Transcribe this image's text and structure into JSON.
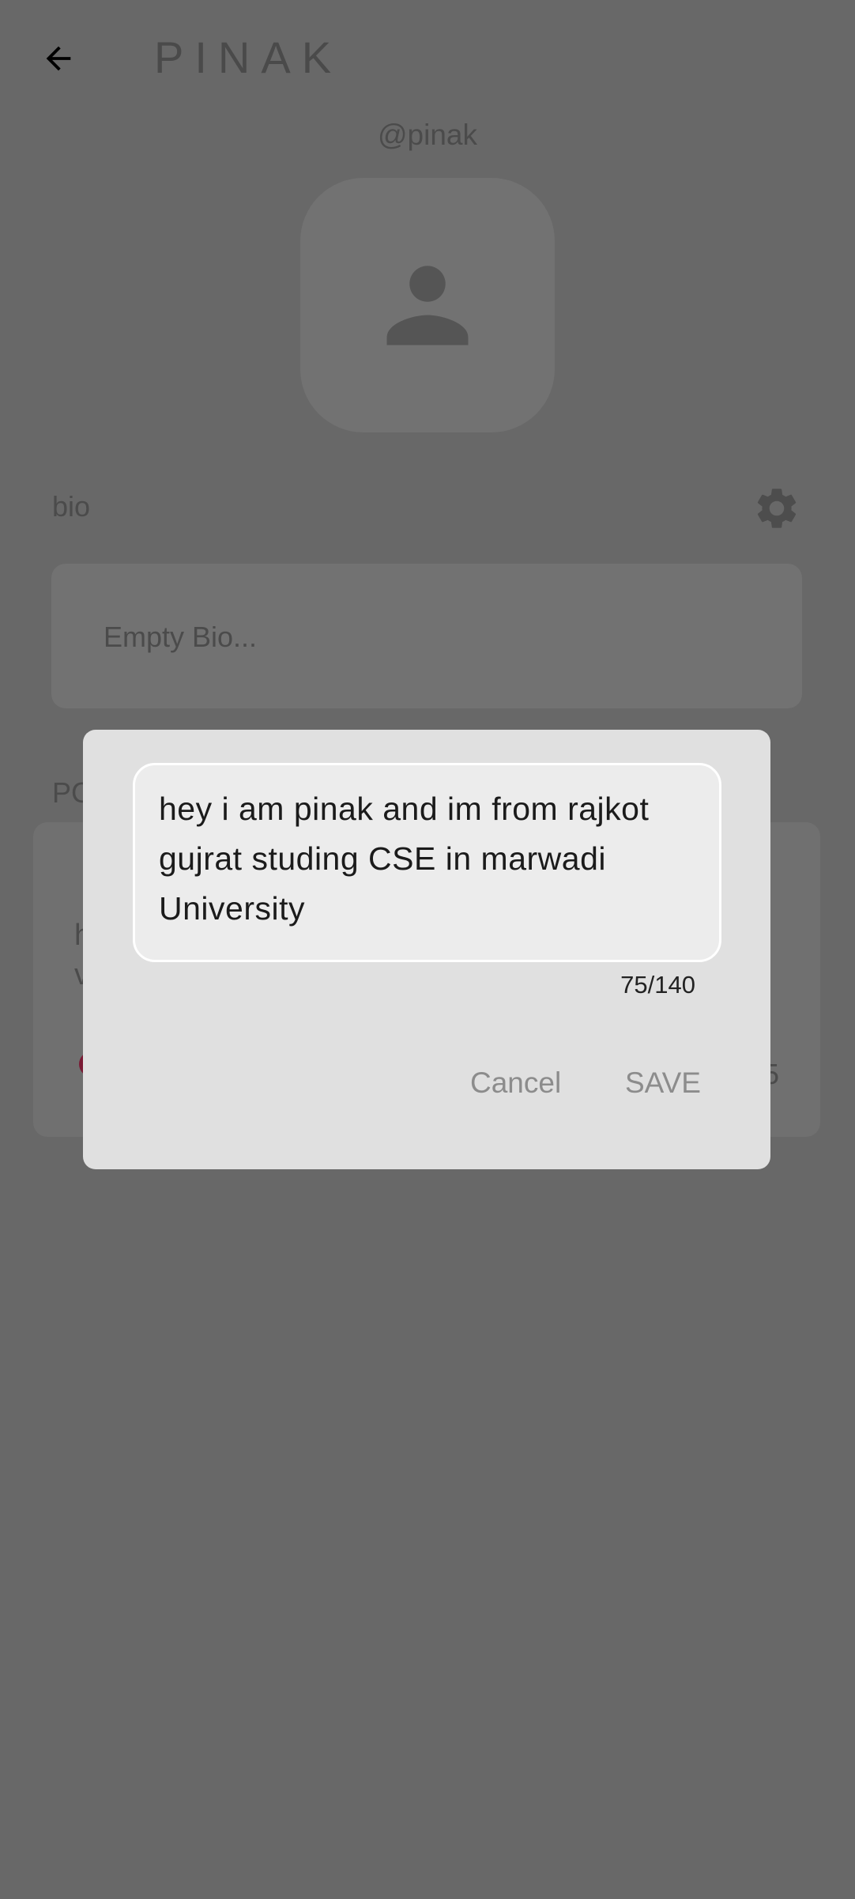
{
  "header": {
    "title": "PINAK",
    "back_icon": "arrow-left-icon"
  },
  "profile": {
    "handle": "@pinak",
    "avatar_icon": "person-icon"
  },
  "bio_section": {
    "label": "bio",
    "settings_icon": "gear-icon",
    "placeholder": "Empty Bio..."
  },
  "posts_section": {
    "label": "PC",
    "post": {
      "text": "h\nv",
      "count": "5"
    }
  },
  "dialog": {
    "bio_value": "hey i am pinak and im from rajkot gujrat studing CSE in marwadi University",
    "counter": "75/140",
    "cancel_label": "Cancel",
    "save_label": "SAVE"
  },
  "colors": {
    "scrim": "#686868",
    "dialog_bg": "#e0e0e0",
    "field_bg": "#ececec",
    "heart": "#7a1a34"
  }
}
